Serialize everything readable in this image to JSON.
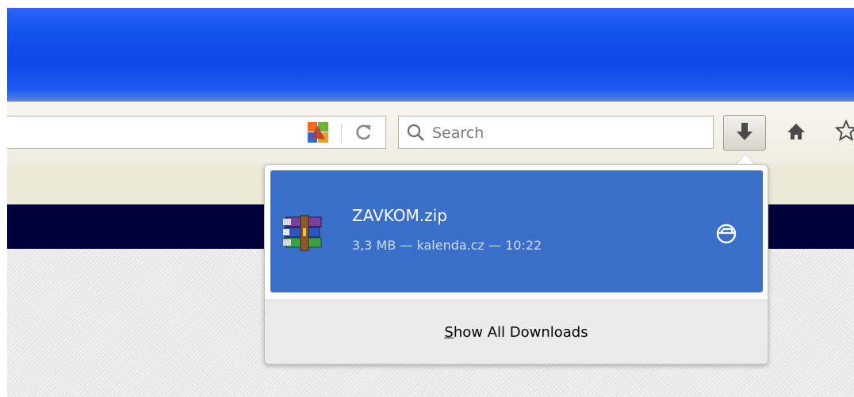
{
  "toolbar": {
    "search": {
      "placeholder": "Search"
    },
    "icons": {
      "addon": "avg-addon-icon",
      "reload": "reload-icon",
      "search": "search-icon",
      "download": "download-arrow-icon",
      "home": "home-icon",
      "bookmark": "bookmark-star-icon"
    }
  },
  "downloads_panel": {
    "items": [
      {
        "file_name": "ZAVKOM.zip",
        "meta": "3,3 MB — kalenda.cz — 10:22",
        "icon": "winrar-archive-icon",
        "action_icon": "open-folder-icon"
      }
    ],
    "footer": {
      "show_all_accesskey": "S",
      "show_all_rest": "how All Downloads"
    }
  },
  "colors": {
    "titlebar": "#1453ee",
    "item_highlight": "#3a6fc9",
    "navy_band": "#00003b",
    "toolbar": "#ece9d8"
  }
}
